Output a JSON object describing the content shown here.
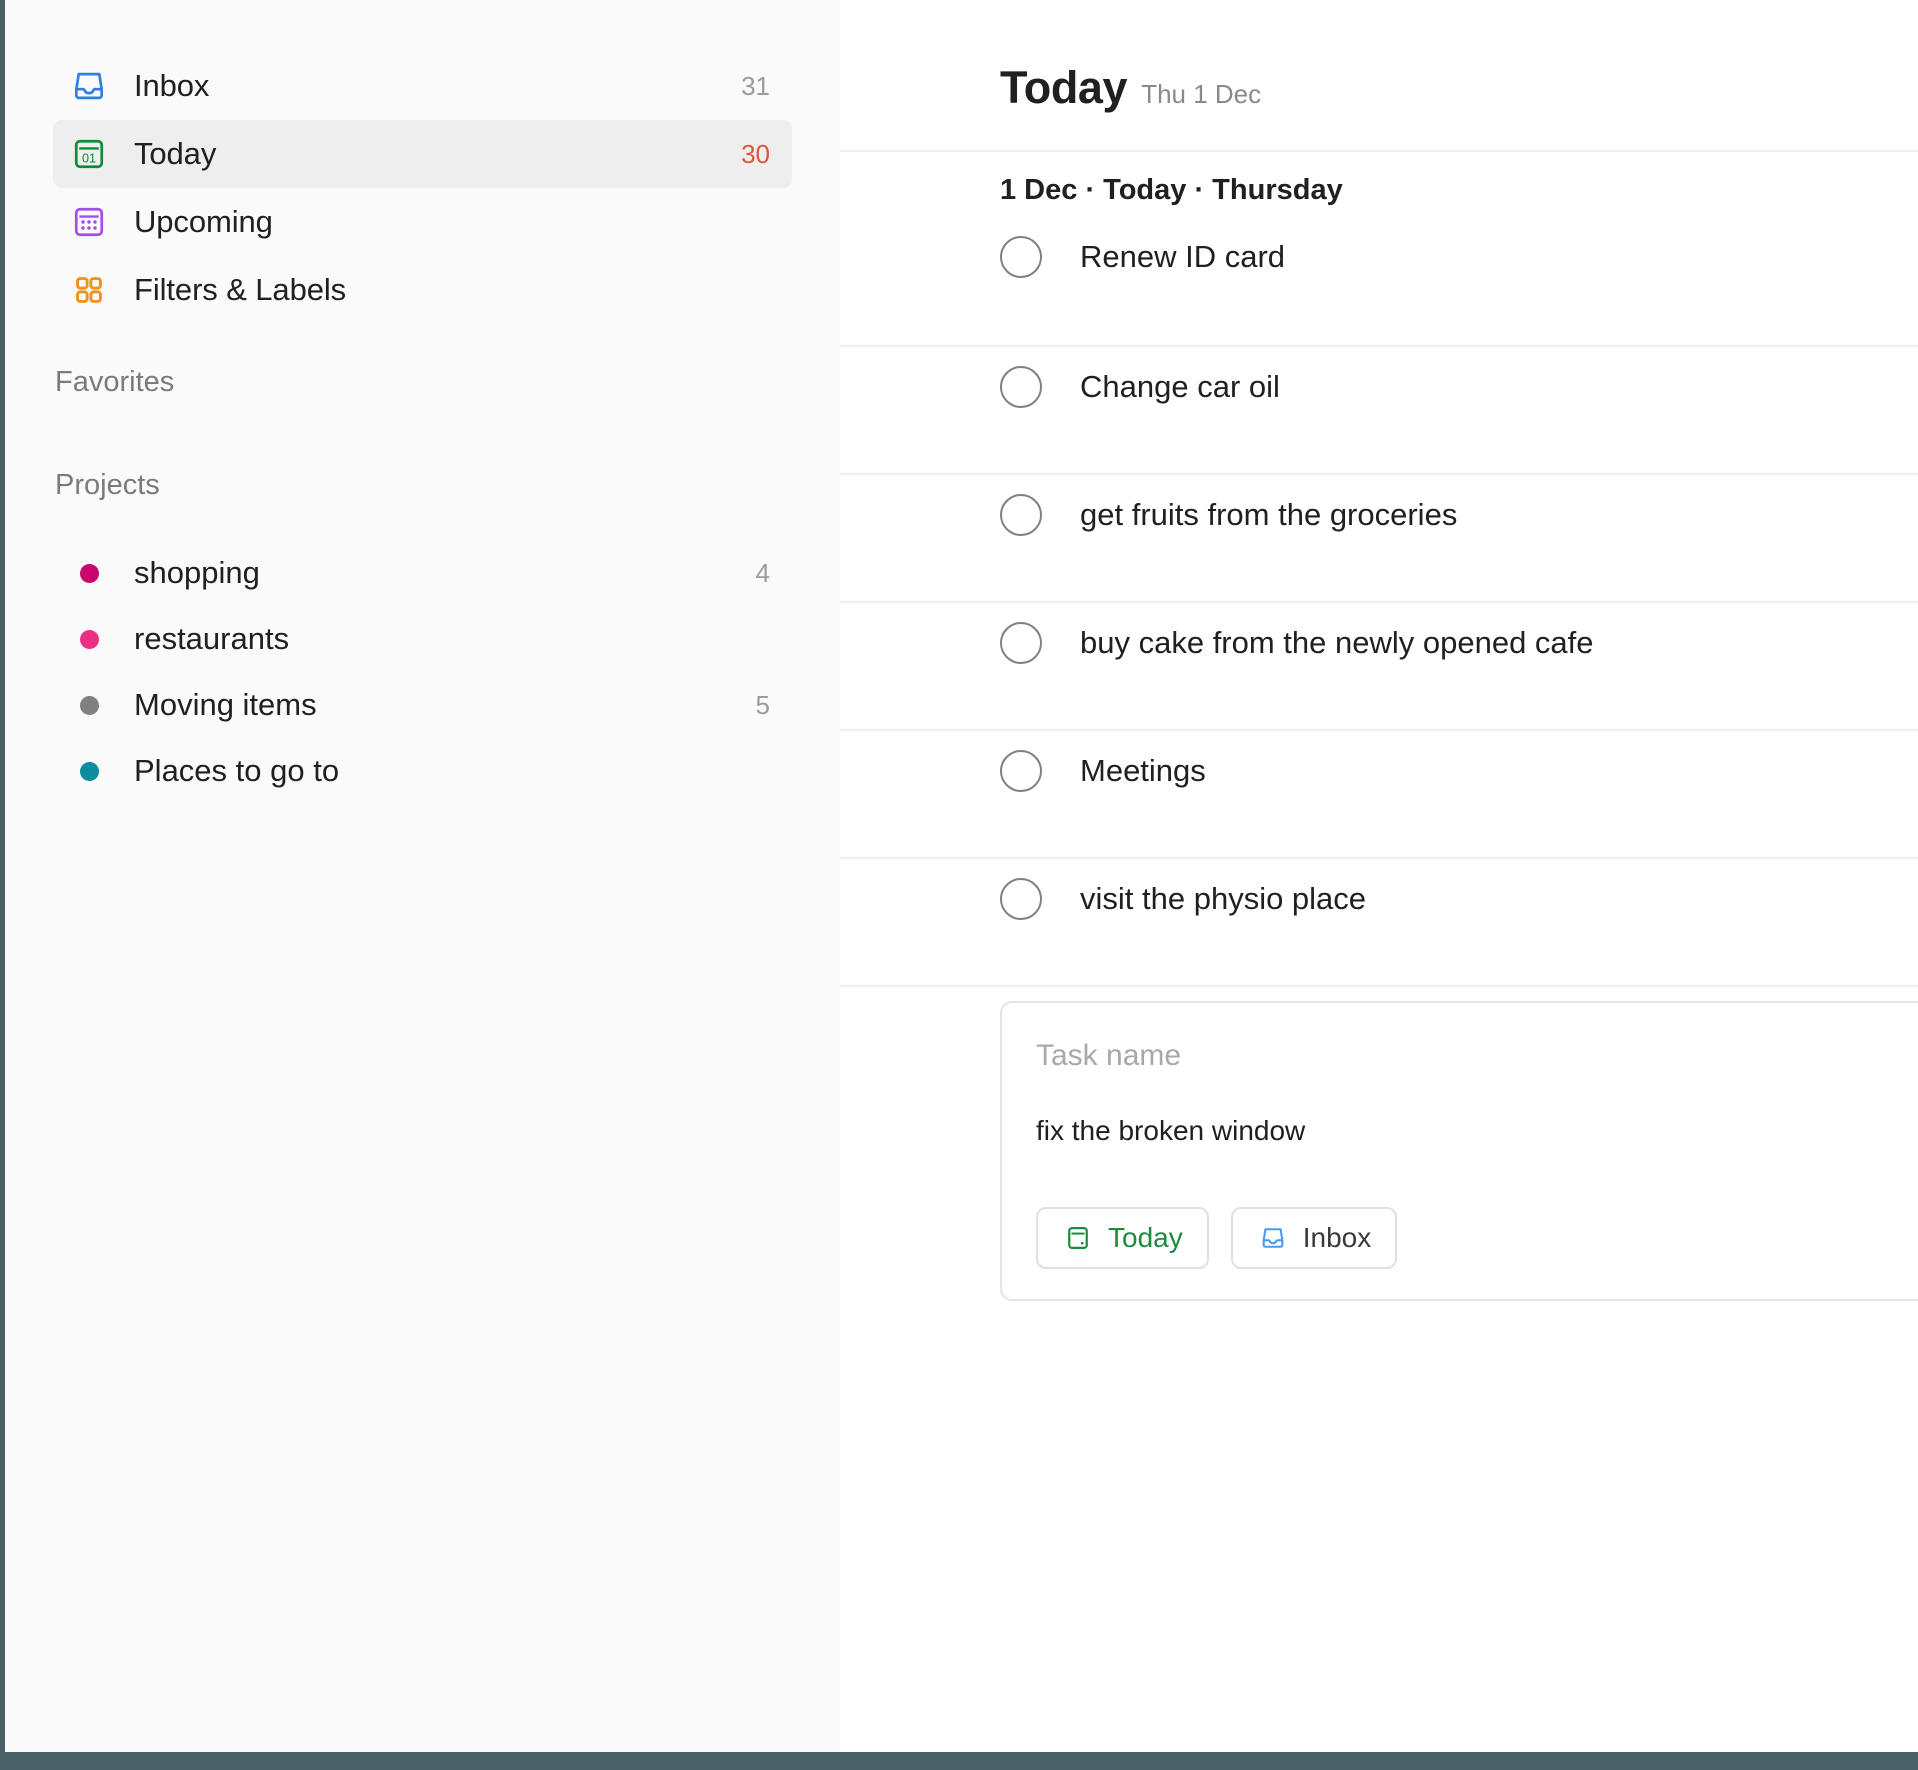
{
  "app": {
    "accent_red": "#e0563a",
    "sidebar_bg": "#fafafa",
    "rail_color": "#4a6168"
  },
  "sidebar": {
    "nav": [
      {
        "label": "Inbox",
        "count": "31",
        "icon": "inbox-icon",
        "icon_color": "#2f7fe0",
        "active": false,
        "count_accent": false
      },
      {
        "label": "Today",
        "count": "30",
        "icon": "calendar-today-icon",
        "icon_color": "#0f8a36",
        "active": true,
        "count_accent": true
      },
      {
        "label": "Upcoming",
        "count": "",
        "icon": "calendar-grid-icon",
        "icon_color": "#a24de8",
        "active": false,
        "count_accent": false
      },
      {
        "label": "Filters & Labels",
        "count": "",
        "icon": "filters-labels-icon",
        "icon_color": "#f0921e",
        "active": false,
        "count_accent": false
      }
    ],
    "favorites_title": "Favorites",
    "projects_title": "Projects",
    "projects": [
      {
        "label": "shopping",
        "count": "4",
        "dot_color": "#c9066e"
      },
      {
        "label": "restaurants",
        "count": "",
        "dot_color": "#ec2f82"
      },
      {
        "label": "Moving items",
        "count": "5",
        "dot_color": "#808080"
      },
      {
        "label": "Places to go to",
        "count": "",
        "dot_color": "#0d8ba1"
      }
    ]
  },
  "main": {
    "title": "Today",
    "subtitle": "Thu 1 Dec",
    "day_header": "1 Dec · Today · Thursday",
    "tasks": [
      {
        "title": "Renew ID card"
      },
      {
        "title": "Change car oil"
      },
      {
        "title": "get fruits from the groceries"
      },
      {
        "title": "buy cake from the newly opened cafe"
      },
      {
        "title": "Meetings"
      },
      {
        "title": "visit the physio place"
      }
    ],
    "composer": {
      "placeholder": "Task name",
      "value": "fix the broken window",
      "date_chip_label": "Today",
      "project_chip_label": "Inbox"
    }
  }
}
